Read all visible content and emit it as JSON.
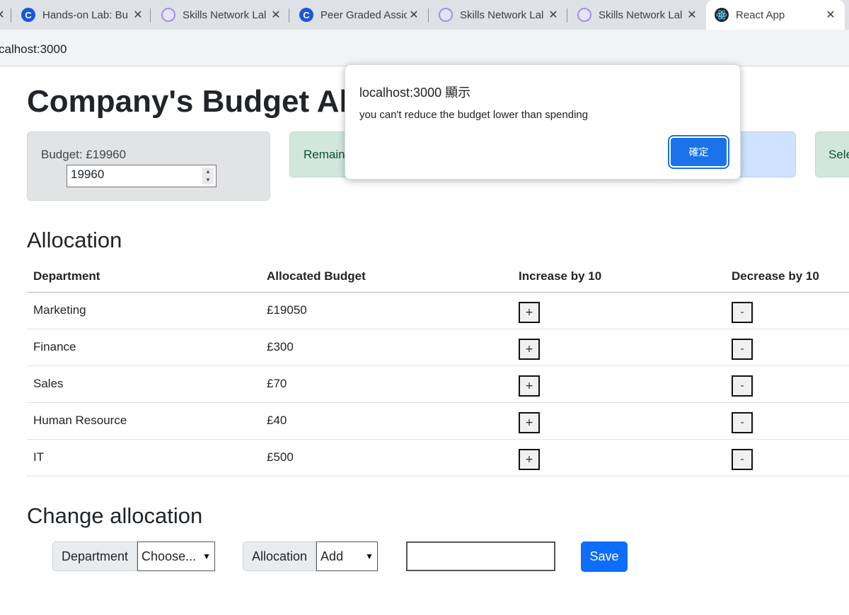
{
  "browser": {
    "tabs": [
      {
        "title": "Hands-on Lab: Bu",
        "icon": "coursera-icon"
      },
      {
        "title": "Skills Network Lal",
        "icon": "skills-network-icon"
      },
      {
        "title": "Peer Graded Assic",
        "icon": "coursera-icon"
      },
      {
        "title": "Skills Network Lal",
        "icon": "skills-network-icon"
      },
      {
        "title": "Skills Network Lal",
        "icon": "skills-network-icon"
      },
      {
        "title": "React App",
        "icon": "react-icon"
      }
    ],
    "address": "calhost:3000"
  },
  "page": {
    "title": "Company's Budget All",
    "budget": {
      "label": "Budget: £19960",
      "value": "19960"
    },
    "remaining": {
      "label": "Remain"
    },
    "currency": {
      "label": "Sele"
    },
    "allocation_heading": "Allocation",
    "table": {
      "headers": [
        "Department",
        "Allocated Budget",
        "Increase by 10",
        "Decrease by 10"
      ],
      "rows": [
        {
          "department": "Marketing",
          "budget": "£19050"
        },
        {
          "department": "Finance",
          "budget": "£300"
        },
        {
          "department": "Sales",
          "budget": "£70"
        },
        {
          "department": "Human Resource",
          "budget": "£40"
        },
        {
          "department": "IT",
          "budget": "£500"
        }
      ],
      "increase_label": "+",
      "decrease_label": "-"
    },
    "change_heading": "Change allocation",
    "change_form": {
      "department_label": "Department",
      "department_value": "Choose...",
      "allocation_label": "Allocation",
      "allocation_value": "Add",
      "amount_value": "",
      "save_label": "Save"
    }
  },
  "dialog": {
    "title": "localhost:3000 顯示",
    "message": "you can't reduce the budget lower than spending",
    "ok_label": "確定"
  },
  "colors": {
    "primary": "#0d6efd",
    "dialog_button": "#1a73e8",
    "success_bg": "#d1e7dd",
    "secondary_bg": "#e2e3e5",
    "info_bg": "#cfe2ff"
  }
}
